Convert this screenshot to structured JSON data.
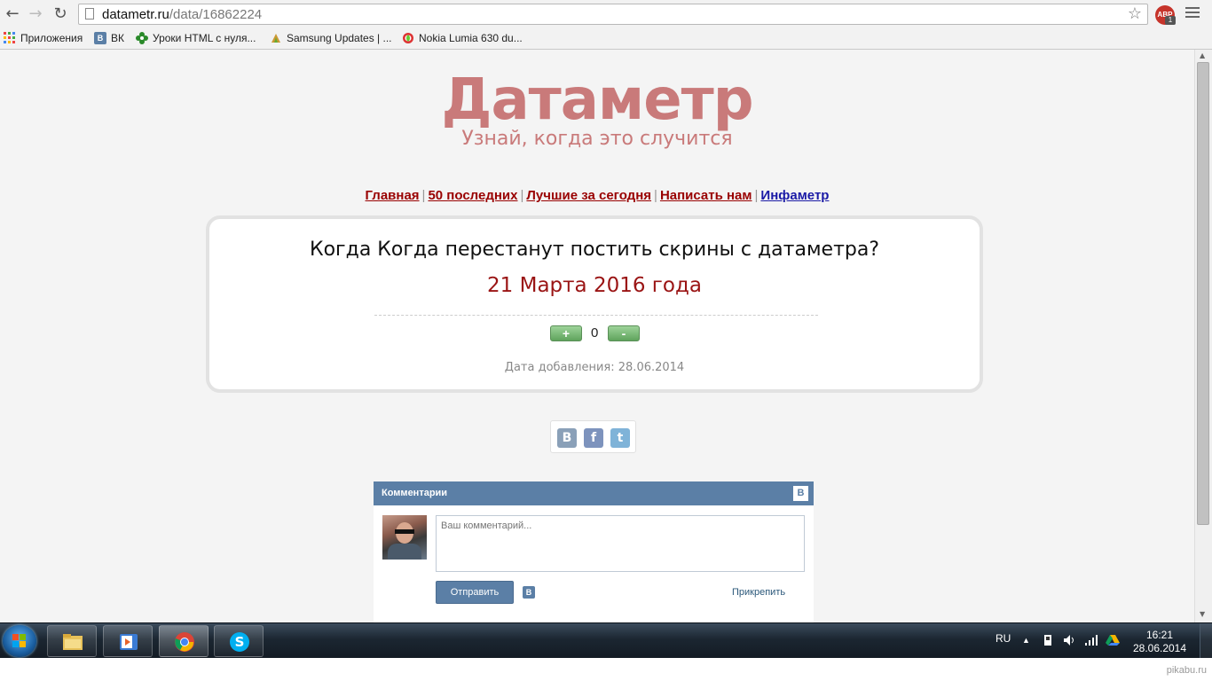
{
  "browser": {
    "url_host": "datametr.ru",
    "url_path": "/data/16862224",
    "abp_label": "ABP",
    "abp_badge": "1",
    "bookmarks": [
      {
        "label": "Приложения",
        "icon": "apps-grid-icon"
      },
      {
        "label": "ВК",
        "icon": "vk-icon"
      },
      {
        "label": "Уроки HTML с нуля...",
        "icon": "green-flower-icon"
      },
      {
        "label": "Samsung Updates | ...",
        "icon": "samsung-updates-icon"
      },
      {
        "label": "Nokia Lumia 630 du...",
        "icon": "opera-icon"
      }
    ]
  },
  "site": {
    "logo": "Датаметр",
    "slogan": "Узнай, когда это случится",
    "nav": [
      "Главная",
      "50 последних",
      "Лучшие за сегодня",
      "Написать нам",
      "Инфаметр"
    ],
    "question": "Когда Когда перестанут постить скрины с датаметра?",
    "answer": "21 Марта 2016 года",
    "plus": "+",
    "minus": "-",
    "score": "0",
    "added": "Дата добавления: 28.06.2014",
    "share": [
      "В",
      "f",
      "t"
    ]
  },
  "comments": {
    "title": "Комментарии",
    "vk_letter": "В",
    "placeholder": "Ваш комментарий...",
    "send": "Отправить",
    "attach": "Прикрепить"
  },
  "taskbar": {
    "lang": "RU",
    "time": "16:21",
    "date": "28.06.2014"
  },
  "watermark": "pikabu.ru",
  "colors": {
    "brand": "#c97a7a",
    "answer": "#9a1414",
    "nav_link": "#990000",
    "nav_link_alt": "#1a1aa6",
    "vk_blue": "#5b7fa6"
  }
}
